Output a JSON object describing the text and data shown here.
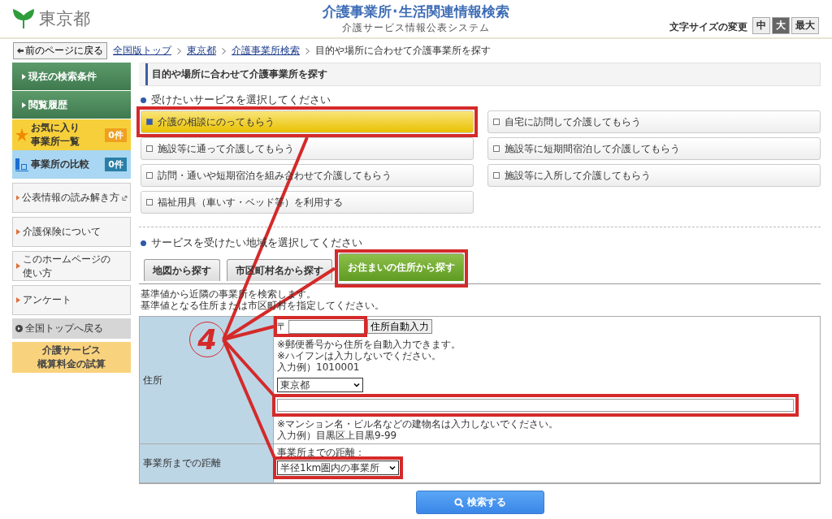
{
  "header": {
    "logo": "東京都",
    "title": "介護事業所･生活関連情報検索",
    "subtitle": "介護サービス情報公表システム",
    "font_size_label": "文字サイズの変更",
    "font_sizes": [
      {
        "label": "中",
        "selected": false
      },
      {
        "label": "大",
        "selected": true
      },
      {
        "label": "最大",
        "selected": false
      }
    ]
  },
  "breadcrumb": {
    "back": "前のページに戻る",
    "links": [
      "全国版トップ",
      "東京都",
      "介護事業所検索"
    ],
    "current": "目的や場所に合わせて介護事業所を探す"
  },
  "sidebar": [
    {
      "kind": "primary",
      "lines": [
        "現在の検索条件"
      ]
    },
    {
      "kind": "primary",
      "lines": [
        "閲覧履歴"
      ]
    },
    {
      "kind": "favorite",
      "lines": [
        "お気に入り",
        "事業所一覧"
      ],
      "count": "0件"
    },
    {
      "kind": "compare",
      "lines": [
        "事業所の比較"
      ],
      "count": "0件"
    },
    {
      "kind": "link",
      "lines": [
        "公表情報の読み解き方"
      ],
      "external": true
    },
    {
      "kind": "link",
      "lines": [
        "介護保険について"
      ],
      "external": false
    },
    {
      "kind": "link",
      "lines": [
        "このホームページの",
        "使い方"
      ],
      "external": false
    },
    {
      "kind": "link",
      "lines": [
        "アンケート"
      ],
      "external": false
    },
    {
      "kind": "return",
      "lines": [
        "全国トップへ戻る"
      ]
    },
    {
      "kind": "calc",
      "lines": [
        "介護サービス",
        "概算料金の試算"
      ]
    }
  ],
  "heading": "目的や場所に合わせて介護事業所を探す",
  "services": {
    "title": "受けたいサービスを選択してください",
    "options": [
      {
        "label": "介護の相談にのってもらう",
        "checked": true
      },
      {
        "label": "自宅に訪問して介護してもらう",
        "checked": false
      },
      {
        "label": "施設等に通って介護してもらう",
        "checked": false
      },
      {
        "label": "施設等に短期間宿泊して介護してもらう",
        "checked": false
      },
      {
        "label": "訪問・通いや短期宿泊を組み合わせて介護してもらう",
        "checked": false
      },
      {
        "label": "施設等に入所して介護してもらう",
        "checked": false
      },
      {
        "label": "福祉用具（車いす・ベッド等）を利用する",
        "checked": false
      }
    ]
  },
  "area": {
    "title": "サービスを受けたい地域を選択してください",
    "tabs": [
      {
        "label": "地図から探す",
        "selected": false
      },
      {
        "label": "市区町村名から探す",
        "selected": false
      },
      {
        "label": "お住まいの住所から探す",
        "selected": true
      }
    ],
    "intro": [
      "基準値から近隣の事業所を検索します。",
      "基準値となる住所または市区町村を指定してください。"
    ]
  },
  "form": {
    "address_label": "住所",
    "zip_prefix": "〒",
    "zip_button": "住所自動入力",
    "zip_notes": [
      "※郵便番号から住所を自動入力できます。",
      "※ハイフンは入力しないでください。",
      "入力例）1010001"
    ],
    "prefecture": "東京都",
    "address_notes": [
      "※マンション名・ビル名などの建物名は入力しないでください。",
      "入力例）目黒区上目黒9-99"
    ],
    "distance_label": "事業所までの距離",
    "distance_caption": "事業所までの距離：",
    "distance": "半径1km圏内の事業所"
  },
  "search_button": "検索する",
  "annotation": {
    "marker": "4"
  }
}
